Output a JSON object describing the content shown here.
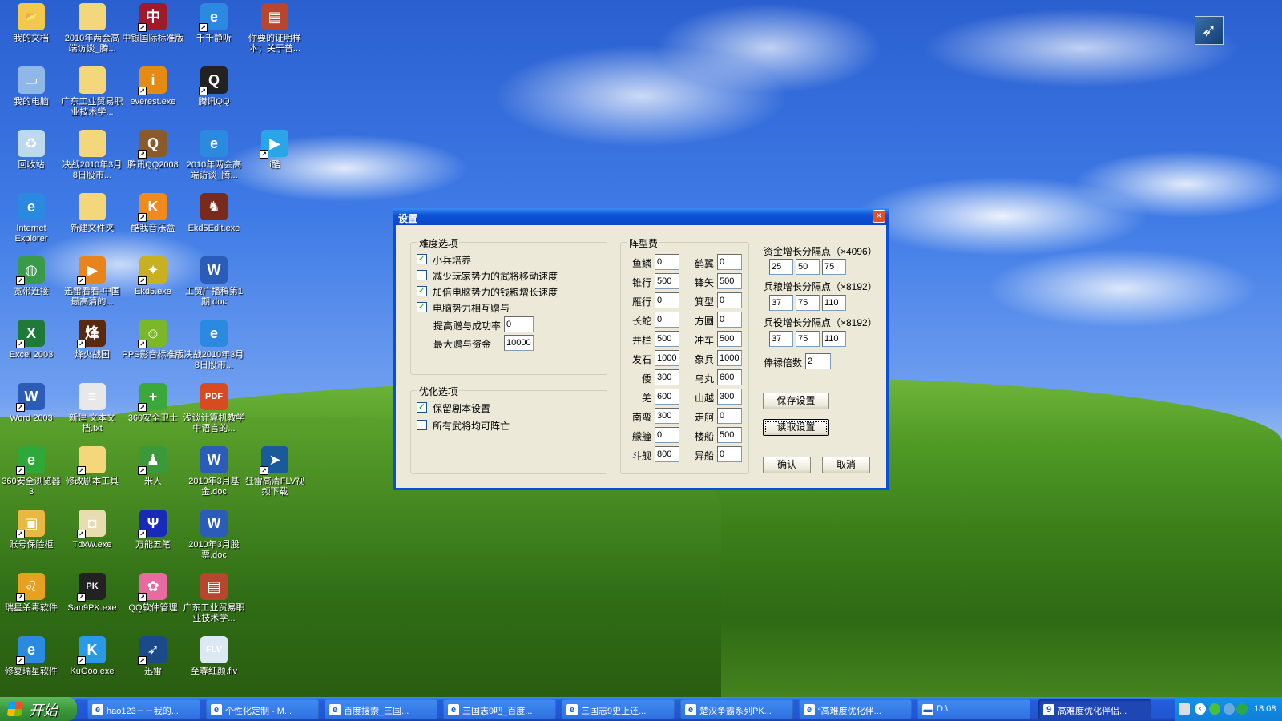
{
  "desktop": {
    "icons": [
      {
        "label": "我的文档",
        "col": 0,
        "row": 0,
        "color": "#f2c94c",
        "glyph": "📂",
        "shortcut": false,
        "icon": "my-documents-icon"
      },
      {
        "label": "2010年两会高端访谈_腾...",
        "col": 1,
        "row": 0,
        "color": "#f4d77a",
        "glyph": "",
        "shortcut": false,
        "icon": "folder-icon"
      },
      {
        "label": "中银国际标准版",
        "col": 2,
        "row": 0,
        "color": "#a01a2a",
        "glyph": "中",
        "shortcut": true,
        "icon": "boc-icon"
      },
      {
        "label": "千千静听",
        "col": 3,
        "row": 0,
        "color": "#2b8ae0",
        "glyph": "e",
        "shortcut": true,
        "icon": "ie-icon"
      },
      {
        "label": "你要的证明样本；关于普...",
        "col": 4,
        "row": 0,
        "color": "#b8452e",
        "glyph": "▤",
        "shortcut": false,
        "icon": "winrar-icon"
      },
      {
        "label": "我的电脑",
        "col": 0,
        "row": 1,
        "color": "#8fb8e8",
        "glyph": "▭",
        "shortcut": false,
        "icon": "my-computer-icon"
      },
      {
        "label": "广东工业贸易职业技术学...",
        "col": 1,
        "row": 1,
        "color": "#f4d77a",
        "glyph": "",
        "shortcut": false,
        "icon": "folder-icon"
      },
      {
        "label": "everest.exe",
        "col": 2,
        "row": 1,
        "color": "#e58a12",
        "glyph": "i",
        "shortcut": true,
        "icon": "everest-icon"
      },
      {
        "label": "腾讯QQ",
        "col": 3,
        "row": 1,
        "color": "#222",
        "glyph": "Q",
        "shortcut": true,
        "icon": "qq-penguin-icon"
      },
      {
        "label": "回收站",
        "col": 0,
        "row": 2,
        "color": "#bcd9ee",
        "glyph": "♻",
        "shortcut": false,
        "icon": "recycle-bin-icon"
      },
      {
        "label": "决战2010年3月8日股市...",
        "col": 1,
        "row": 2,
        "color": "#f4d77a",
        "glyph": "",
        "shortcut": false,
        "icon": "folder-icon"
      },
      {
        "label": "腾讯QQ2008",
        "col": 2,
        "row": 2,
        "color": "#8a5a2a",
        "glyph": "Q",
        "shortcut": true,
        "icon": "qq2008-icon"
      },
      {
        "label": "2010年两会高端访谈_腾...",
        "col": 3,
        "row": 2,
        "color": "#2b8ae0",
        "glyph": "e",
        "shortcut": false,
        "icon": "ie-document-icon"
      },
      {
        "label": "i酷",
        "col": 4,
        "row": 2,
        "color": "#2aa6e8",
        "glyph": "▶",
        "shortcut": true,
        "icon": "iku-player-icon"
      },
      {
        "label": "Internet Explorer",
        "col": 0,
        "row": 3,
        "color": "#2b8ae0",
        "glyph": "e",
        "shortcut": false,
        "icon": "internet-explorer-icon"
      },
      {
        "label": "新建文件夹",
        "col": 1,
        "row": 3,
        "color": "#f4d77a",
        "glyph": "",
        "shortcut": false,
        "icon": "folder-icon"
      },
      {
        "label": "酷我音乐盒",
        "col": 2,
        "row": 3,
        "color": "#f08a1c",
        "glyph": "K",
        "shortcut": true,
        "icon": "kuwo-music-icon"
      },
      {
        "label": "Ekd5Edit.exe",
        "col": 3,
        "row": 3,
        "color": "#7a2a1a",
        "glyph": "♞",
        "shortcut": false,
        "icon": "horseman-icon"
      },
      {
        "label": "宽带连接",
        "col": 0,
        "row": 4,
        "color": "#3a9a4a",
        "glyph": "◍",
        "shortcut": true,
        "icon": "broadband-icon"
      },
      {
        "label": "迅雷看看-中国最高清的...",
        "col": 1,
        "row": 4,
        "color": "#e8841c",
        "glyph": "▶",
        "shortcut": true,
        "icon": "xunlei-kankan-icon"
      },
      {
        "label": "Ekd5.exe",
        "col": 2,
        "row": 4,
        "color": "#c8b020",
        "glyph": "✦",
        "shortcut": true,
        "icon": "eagle-icon"
      },
      {
        "label": "工贸广播稿第1期.doc",
        "col": 3,
        "row": 4,
        "color": "#2a5cb8",
        "glyph": "W",
        "shortcut": false,
        "icon": "word-doc-icon"
      },
      {
        "label": "Excel 2003",
        "col": 0,
        "row": 5,
        "color": "#1f7a3a",
        "glyph": "X",
        "shortcut": true,
        "icon": "excel-icon"
      },
      {
        "label": "烽火战国",
        "col": 1,
        "row": 5,
        "color": "#5a2a10",
        "glyph": "烽",
        "shortcut": true,
        "icon": "fenghuo-icon"
      },
      {
        "label": "PPS影音标准版",
        "col": 2,
        "row": 5,
        "color": "#7ab82a",
        "glyph": "☺",
        "shortcut": true,
        "icon": "pps-icon"
      },
      {
        "label": "决战2010年3月8日股市...",
        "col": 3,
        "row": 5,
        "color": "#2b8ae0",
        "glyph": "e",
        "shortcut": false,
        "icon": "ie-document-icon"
      },
      {
        "label": "Word 2003",
        "col": 0,
        "row": 6,
        "color": "#2a5cb8",
        "glyph": "W",
        "shortcut": true,
        "icon": "word-icon"
      },
      {
        "label": "新建 文本文档.txt",
        "col": 1,
        "row": 6,
        "color": "#e8e8e8",
        "glyph": "≡",
        "shortcut": false,
        "icon": "text-file-icon"
      },
      {
        "label": "360安全卫士",
        "col": 2,
        "row": 6,
        "color": "#3aa83a",
        "glyph": "+",
        "shortcut": true,
        "icon": "360-safe-icon"
      },
      {
        "label": "浅谈计算机教学中语言的...",
        "col": 3,
        "row": 6,
        "color": "#d84a20",
        "glyph": "PDF",
        "shortcut": false,
        "icon": "pdf-icon"
      },
      {
        "label": "360安全浏览器 3",
        "col": 0,
        "row": 7,
        "color": "#2fa83a",
        "glyph": "e",
        "shortcut": true,
        "icon": "360-browser-icon"
      },
      {
        "label": "修改剧本工具",
        "col": 1,
        "row": 7,
        "color": "#f4d77a",
        "glyph": "",
        "shortcut": true,
        "icon": "folder-icon"
      },
      {
        "label": "米人",
        "col": 2,
        "row": 7,
        "color": "#3a9a3a",
        "glyph": "♟",
        "shortcut": true,
        "icon": "person-icon"
      },
      {
        "label": "2010年3月基金.doc",
        "col": 3,
        "row": 7,
        "color": "#2a5cb8",
        "glyph": "W",
        "shortcut": false,
        "icon": "word-doc-icon"
      },
      {
        "label": "狂雷高清FLV视频下载",
        "col": 4,
        "row": 7,
        "color": "#1a5a9a",
        "glyph": "➤",
        "shortcut": true,
        "icon": "flv-downloader-icon"
      },
      {
        "label": "账号保险柜",
        "col": 0,
        "row": 8,
        "color": "#e8b840",
        "glyph": "▣",
        "shortcut": true,
        "icon": "safe-box-icon"
      },
      {
        "label": "TdxW.exe",
        "col": 1,
        "row": 8,
        "color": "#e8dcb0",
        "glyph": "◘",
        "shortcut": true,
        "icon": "coin-icon"
      },
      {
        "label": "万能五笔",
        "col": 2,
        "row": 8,
        "color": "#1a2ab8",
        "glyph": "Ψ",
        "shortcut": true,
        "icon": "wubi-icon"
      },
      {
        "label": "2010年3月股票.doc",
        "col": 3,
        "row": 8,
        "color": "#2a5cb8",
        "glyph": "W",
        "shortcut": false,
        "icon": "word-doc-icon"
      },
      {
        "label": "瑞星杀毒软件",
        "col": 0,
        "row": 9,
        "color": "#e8a020",
        "glyph": "♌",
        "shortcut": true,
        "icon": "rising-antivirus-icon"
      },
      {
        "label": "San9PK.exe",
        "col": 1,
        "row": 9,
        "color": "#222",
        "glyph": "PK",
        "shortcut": true,
        "icon": "san9pk-icon"
      },
      {
        "label": "QQ软件管理",
        "col": 2,
        "row": 9,
        "color": "#e86aa0",
        "glyph": "✿",
        "shortcut": true,
        "icon": "qq-software-manager-icon"
      },
      {
        "label": "广东工业贸易职业技术学...",
        "col": 3,
        "row": 9,
        "color": "#b8452e",
        "glyph": "▤",
        "shortcut": false,
        "icon": "winrar-icon"
      },
      {
        "label": "修复瑞星软件",
        "col": 0,
        "row": 10,
        "color": "#2b8ae0",
        "glyph": "e",
        "shortcut": true,
        "icon": "ie-document-icon"
      },
      {
        "label": "KuGoo.exe",
        "col": 1,
        "row": 10,
        "color": "#2a9ae8",
        "glyph": "K",
        "shortcut": true,
        "icon": "kugoo-icon"
      },
      {
        "label": "迅雷",
        "col": 2,
        "row": 10,
        "color": "#1a4a8a",
        "glyph": "➶",
        "shortcut": true,
        "icon": "xunlei-icon"
      },
      {
        "label": "至尊红颜.flv",
        "col": 3,
        "row": 10,
        "color": "#dce8f4",
        "glyph": "FLV",
        "shortcut": false,
        "icon": "flv-file-icon"
      }
    ]
  },
  "dialog": {
    "title": "设置",
    "difficulty": {
      "legend": "难度选项",
      "options": [
        {
          "label": "小兵培养",
          "checked": true
        },
        {
          "label": "减少玩家势力的武将移动速度",
          "checked": false
        },
        {
          "label": "加倍电脑势力的钱粮增长速度",
          "checked": true
        },
        {
          "label": "电脑势力相互赠与",
          "checked": true
        }
      ],
      "gift_rate_label": "提高赠与成功率",
      "gift_rate": "0",
      "max_gift_label": "最大赠与资金",
      "max_gift": "10000"
    },
    "optimize": {
      "legend": "优化选项",
      "options": [
        {
          "label": "保留剧本设置",
          "checked": true
        },
        {
          "label": "所有武将均可阵亡",
          "checked": false
        }
      ]
    },
    "formation": {
      "legend": "阵型费",
      "rows": [
        [
          "鱼鳞",
          "0",
          "鹤翼",
          "0"
        ],
        [
          "锥行",
          "500",
          "锋矢",
          "500"
        ],
        [
          "雁行",
          "0",
          "箕型",
          "0"
        ],
        [
          "长蛇",
          "0",
          "方圆",
          "0"
        ],
        [
          "井栏",
          "500",
          "冲车",
          "500"
        ],
        [
          "发石",
          "1000",
          "象兵",
          "1000"
        ],
        [
          "倭",
          "300",
          "乌丸",
          "600"
        ],
        [
          "羌",
          "600",
          "山越",
          "300"
        ],
        [
          "南蛮",
          "300",
          "走舸",
          "0"
        ],
        [
          "艨艟",
          "0",
          "楼船",
          "500"
        ],
        [
          "斗舰",
          "800",
          "异船",
          "0"
        ]
      ]
    },
    "fund_growth": {
      "label": "资金增长分隔点（×4096）",
      "values": [
        "25",
        "50",
        "75"
      ]
    },
    "food_growth": {
      "label": "兵粮增长分隔点（×8192）",
      "values": [
        "37",
        "75",
        "110"
      ]
    },
    "troop_growth": {
      "label": "兵役增长分隔点（×8192）",
      "values": [
        "37",
        "75",
        "110"
      ]
    },
    "salary_label": "俸禄倍数",
    "salary": "2",
    "save_label": "保存设置",
    "load_label": "读取设置",
    "ok_label": "确认",
    "cancel_label": "取消"
  },
  "taskbar": {
    "start_label": "开始",
    "tasks": [
      {
        "label": "hao123－－我的...",
        "icon": "ie-icon",
        "active": false
      },
      {
        "label": "个性化定制 - M...",
        "icon": "ie-icon",
        "active": false
      },
      {
        "label": "百度搜索_三国...",
        "icon": "ie-icon",
        "active": false
      },
      {
        "label": "三国志9吧_百度...",
        "icon": "ie-icon",
        "active": false
      },
      {
        "label": "三国志9史上还...",
        "icon": "ie-icon",
        "active": false
      },
      {
        "label": "楚汉争霸系列PK...",
        "icon": "ie-icon",
        "active": false
      },
      {
        "label": "“高难度优化伴...",
        "icon": "ie-icon",
        "active": false
      },
      {
        "label": "D:\\",
        "icon": "drive-icon",
        "active": false
      },
      {
        "label": "高难度优化伴侣...",
        "icon": "app-9-icon",
        "active": true
      }
    ],
    "clock": "18:08"
  }
}
